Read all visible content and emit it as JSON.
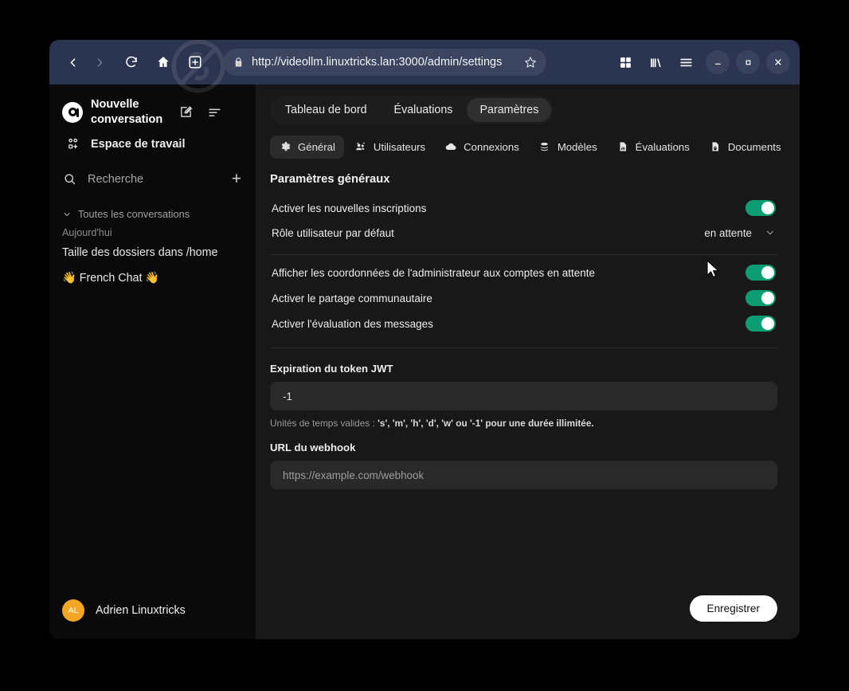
{
  "browser": {
    "back_label": "Retour",
    "forward_label": "Suivant",
    "reload_label": "Recharger",
    "home_label": "Accueil",
    "newtab_label": "Nouvel onglet",
    "url": "http://videollm.linuxtricks.lan:3000/admin/settings",
    "lock_icon": "lock-icon",
    "bookmark_icon": "star-icon",
    "grid_icon": "grid-icon",
    "library_icon": "library-icon",
    "menu_icon": "hamburger-menu-icon",
    "minimize_label": "—",
    "maximize_label": "□",
    "close_label": "×"
  },
  "sidebar": {
    "title": "Nouvelle conversation",
    "new_chat_icon": "edit-square-icon",
    "collapse_icon": "panel-lines-icon",
    "workspace": "Espace de travail",
    "search_placeholder": "Recherche",
    "add_label": "+",
    "group_label": "Toutes les conversations",
    "day_label": "Aujourd'hui",
    "conversations": [
      "Taille des dossiers dans /home",
      "👋 French Chat 👋"
    ],
    "user": {
      "initials": "AL",
      "name": "Adrien Linuxtricks",
      "avatar_color": "#f5a524"
    }
  },
  "main": {
    "tabs": [
      {
        "label": "Tableau de bord",
        "active": false
      },
      {
        "label": "Évaluations",
        "active": false
      },
      {
        "label": "Paramètres",
        "active": true
      }
    ],
    "subtabs": [
      {
        "label": "Général",
        "icon": "gear-icon",
        "active": true
      },
      {
        "label": "Utilisateurs",
        "icon": "users-icon",
        "active": false
      },
      {
        "label": "Connexions",
        "icon": "cloud-icon",
        "active": false
      },
      {
        "label": "Modèles",
        "icon": "stack-icon",
        "active": false
      },
      {
        "label": "Évaluations",
        "icon": "document-chart-icon",
        "active": false
      },
      {
        "label": "Documents",
        "icon": "document-lock-icon",
        "active": false
      }
    ],
    "section_title": "Paramètres généraux",
    "options_top": [
      {
        "label": "Activer les nouvelles inscriptions",
        "type": "toggle",
        "value": true
      }
    ],
    "role_row": {
      "label": "Rôle utilisateur par défaut",
      "value": "en attente",
      "chevron_icon": "chevron-down-icon"
    },
    "options_bottom": [
      {
        "label": "Afficher les coordonnées de l'administrateur aux comptes en attente",
        "type": "toggle",
        "value": true
      },
      {
        "label": "Activer le partage communautaire",
        "type": "toggle",
        "value": true
      },
      {
        "label": "Activer l'évaluation des messages",
        "type": "toggle",
        "value": true
      }
    ],
    "jwt": {
      "label": "Expiration du token JWT",
      "value": "-1",
      "hint_prefix": "Unités de temps valides : ",
      "hint_bold": "'s', 'm', 'h', 'd', 'w' ou '-1' pour une durée illimitée."
    },
    "webhook": {
      "label": "URL du webhook",
      "value": "",
      "placeholder": "https://example.com/webhook"
    },
    "save_label": "Enregistrer"
  },
  "colors": {
    "toggle_on": "#0d9d72",
    "chrome_bg": "#2b3450",
    "sidebar_bg": "#0a0a0a",
    "main_bg": "#181818",
    "accent_white": "#ffffff"
  }
}
